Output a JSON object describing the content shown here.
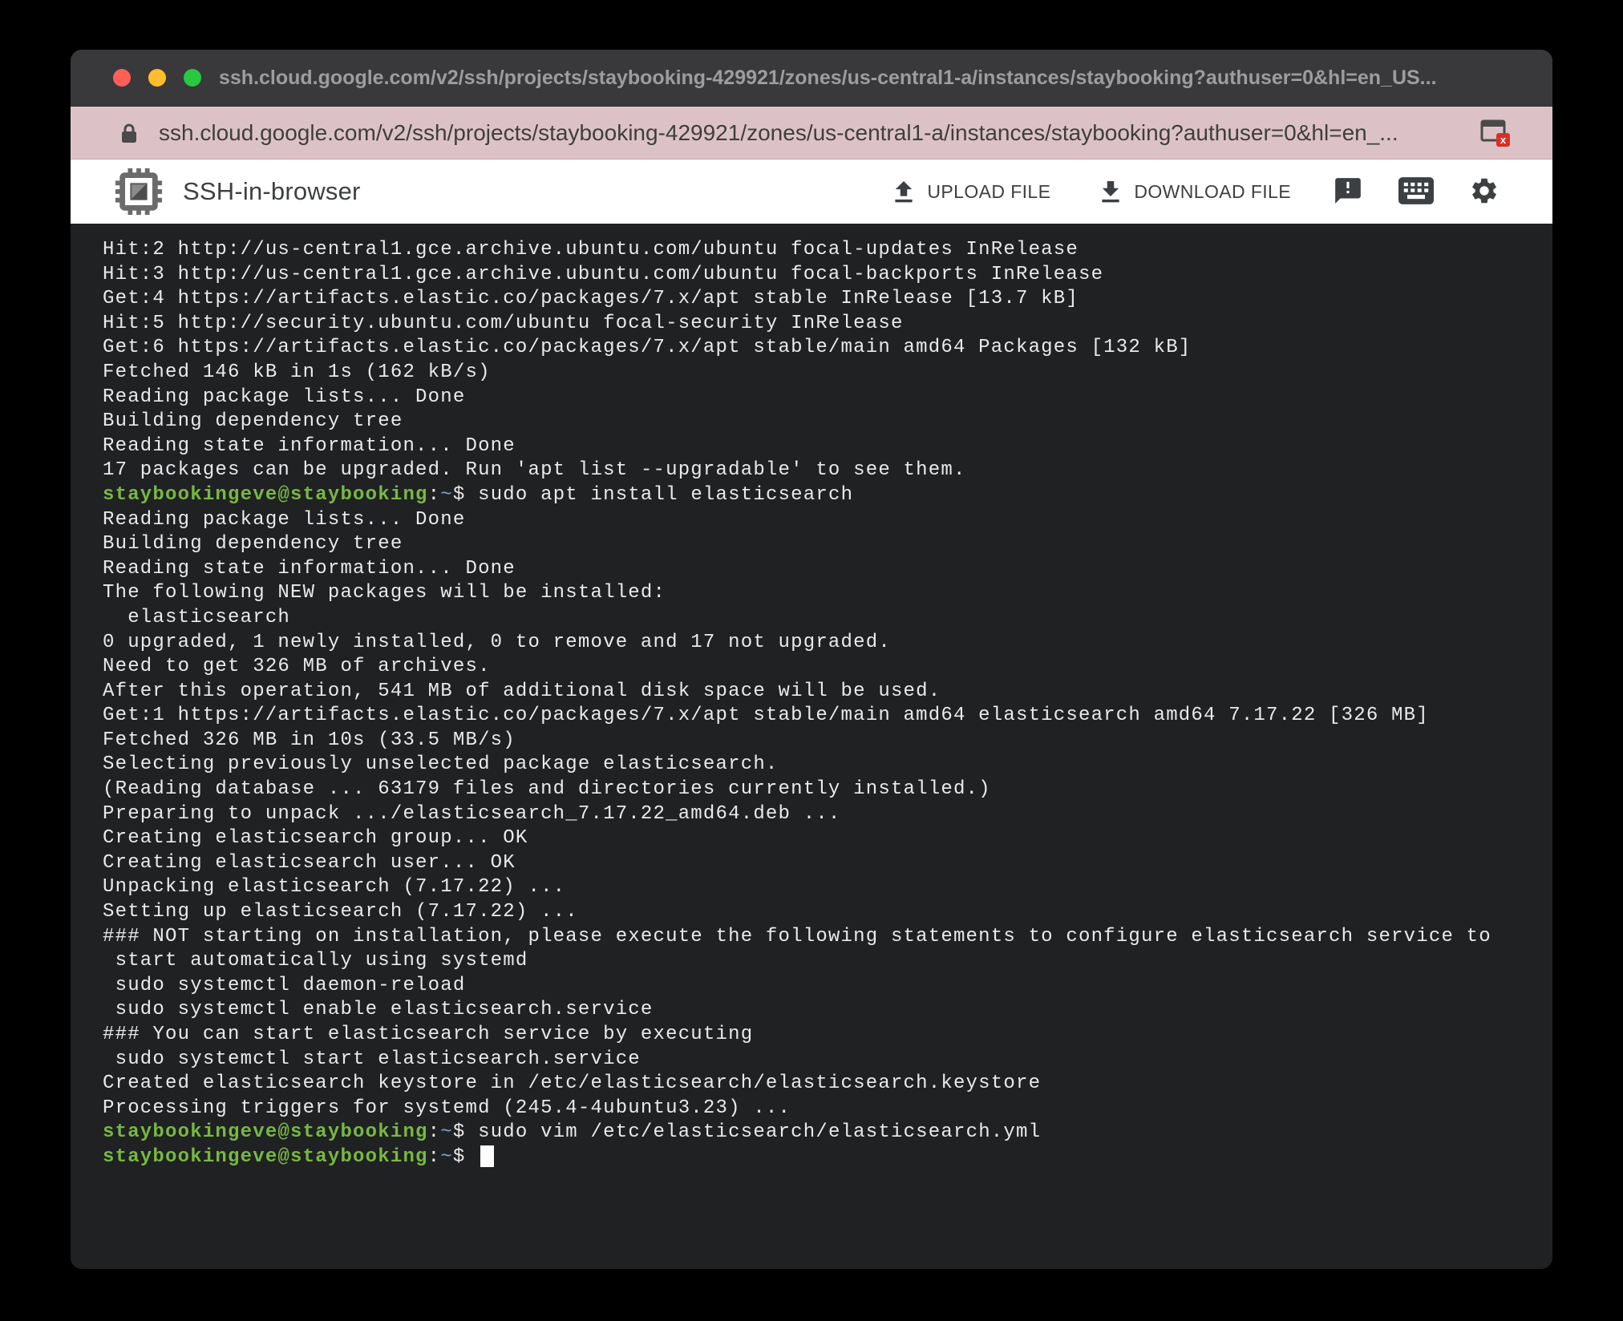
{
  "window": {
    "title": "ssh.cloud.google.com/v2/ssh/projects/staybooking-429921/zones/us-central1-a/instances/staybooking?authuser=0&hl=en_US..."
  },
  "address_bar": {
    "url": "ssh.cloud.google.com/v2/ssh/projects/staybooking-429921/zones/us-central1-a/instances/staybooking?authuser=0&hl=en_...",
    "background_color": "#dcc2c7"
  },
  "toolbar": {
    "app_title": "SSH-in-browser",
    "upload_label": "UPLOAD FILE",
    "download_label": "DOWNLOAD FILE"
  },
  "icons": {
    "traffic_lights": [
      "close-icon",
      "minimize-icon",
      "zoom-icon"
    ],
    "lock": "lock-icon",
    "popup_blocked": "popup-blocked-icon",
    "logo": "chip-logo-icon",
    "upload": "upload-icon",
    "download": "download-icon",
    "feedback": "feedback-icon",
    "keyboard": "keyboard-icon",
    "settings": "gear-icon"
  },
  "colors": {
    "terminal_background": "#202123",
    "terminal_text": "#eaeaea",
    "prompt_user_green": "#77b843",
    "prompt_path_blue": "#7ea6d8",
    "titlebar_background": "#39393b",
    "traffic_red": "#ff5f57",
    "traffic_yellow": "#febc2e",
    "traffic_green": "#2ac840"
  },
  "terminal": {
    "prompt_symbols": {
      "colon": ":",
      "path": "~",
      "dollar": "$"
    },
    "lines": [
      {
        "text": "Hit:2 http://us-central1.gce.archive.ubuntu.com/ubuntu focal-updates InRelease"
      },
      {
        "text": "Hit:3 http://us-central1.gce.archive.ubuntu.com/ubuntu focal-backports InRelease"
      },
      {
        "text": "Get:4 https://artifacts.elastic.co/packages/7.x/apt stable InRelease [13.7 kB]"
      },
      {
        "text": "Hit:5 http://security.ubuntu.com/ubuntu focal-security InRelease"
      },
      {
        "text": "Get:6 https://artifacts.elastic.co/packages/7.x/apt stable/main amd64 Packages [132 kB]"
      },
      {
        "text": "Fetched 146 kB in 1s (162 kB/s)"
      },
      {
        "text": "Reading package lists... Done"
      },
      {
        "text": "Building dependency tree"
      },
      {
        "text": "Reading state information... Done"
      },
      {
        "text": "17 packages can be upgraded. Run 'apt list --upgradable' to see them."
      },
      {
        "user": "staybookingeve@staybooking",
        "cmd": "sudo apt install elasticsearch"
      },
      {
        "text": "Reading package lists... Done"
      },
      {
        "text": "Building dependency tree"
      },
      {
        "text": "Reading state information... Done"
      },
      {
        "text": "The following NEW packages will be installed:"
      },
      {
        "text": "  elasticsearch"
      },
      {
        "text": "0 upgraded, 1 newly installed, 0 to remove and 17 not upgraded."
      },
      {
        "text": "Need to get 326 MB of archives."
      },
      {
        "text": "After this operation, 541 MB of additional disk space will be used."
      },
      {
        "text": "Get:1 https://artifacts.elastic.co/packages/7.x/apt stable/main amd64 elasticsearch amd64 7.17.22 [326 MB]"
      },
      {
        "text": "Fetched 326 MB in 10s (33.5 MB/s)"
      },
      {
        "text": "Selecting previously unselected package elasticsearch."
      },
      {
        "text": "(Reading database ... 63179 files and directories currently installed.)"
      },
      {
        "text": "Preparing to unpack .../elasticsearch_7.17.22_amd64.deb ..."
      },
      {
        "text": "Creating elasticsearch group... OK"
      },
      {
        "text": "Creating elasticsearch user... OK"
      },
      {
        "text": "Unpacking elasticsearch (7.17.22) ..."
      },
      {
        "text": "Setting up elasticsearch (7.17.22) ..."
      },
      {
        "text": "### NOT starting on installation, please execute the following statements to configure elasticsearch service to"
      },
      {
        "text": " start automatically using systemd"
      },
      {
        "text": " sudo systemctl daemon-reload"
      },
      {
        "text": " sudo systemctl enable elasticsearch.service"
      },
      {
        "text": "### You can start elasticsearch service by executing"
      },
      {
        "text": " sudo systemctl start elasticsearch.service"
      },
      {
        "text": "Created elasticsearch keystore in /etc/elasticsearch/elasticsearch.keystore"
      },
      {
        "text": "Processing triggers for systemd (245.4-4ubuntu3.23) ..."
      },
      {
        "user": "staybookingeve@staybooking",
        "cmd": "sudo vim /etc/elasticsearch/elasticsearch.yml"
      },
      {
        "user": "staybookingeve@staybooking",
        "cmd": "",
        "cursor": true
      }
    ]
  }
}
